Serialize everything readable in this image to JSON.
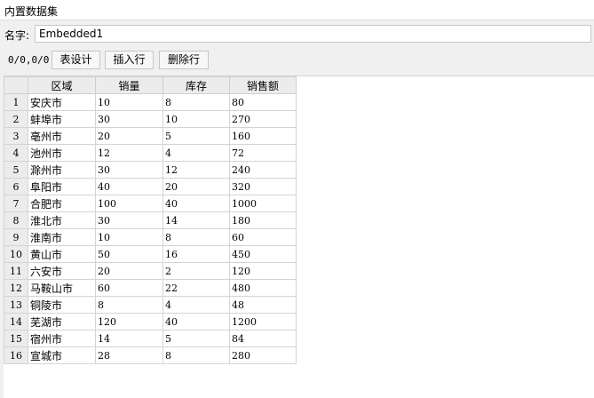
{
  "window": {
    "title": "内置数据集"
  },
  "name_field": {
    "label": "名字:",
    "value": "Embedded1"
  },
  "toolbar": {
    "position_text": "0/0,0/0",
    "design_label": "表设计",
    "insert_label": "插入行",
    "delete_label": "删除行"
  },
  "table": {
    "columns": [
      "区域",
      "销量",
      "库存",
      "销售额"
    ],
    "rows": [
      {
        "num": "1",
        "cells": [
          "安庆市",
          "10",
          "8",
          "80"
        ]
      },
      {
        "num": "2",
        "cells": [
          "蚌埠市",
          "30",
          "10",
          "270"
        ]
      },
      {
        "num": "3",
        "cells": [
          "亳州市",
          "20",
          "5",
          "160"
        ]
      },
      {
        "num": "4",
        "cells": [
          "池州市",
          "12",
          "4",
          "72"
        ]
      },
      {
        "num": "5",
        "cells": [
          "滁州市",
          "30",
          "12",
          "240"
        ]
      },
      {
        "num": "6",
        "cells": [
          "阜阳市",
          "40",
          "20",
          "320"
        ]
      },
      {
        "num": "7",
        "cells": [
          "合肥市",
          "100",
          "40",
          "1000"
        ]
      },
      {
        "num": "8",
        "cells": [
          "淮北市",
          "30",
          "14",
          "180"
        ]
      },
      {
        "num": "9",
        "cells": [
          "淮南市",
          "10",
          "8",
          "60"
        ]
      },
      {
        "num": "10",
        "cells": [
          "黄山市",
          "50",
          "16",
          "450"
        ]
      },
      {
        "num": "11",
        "cells": [
          "六安市",
          "20",
          "2",
          "120"
        ]
      },
      {
        "num": "12",
        "cells": [
          "马鞍山市",
          "60",
          "22",
          "480"
        ]
      },
      {
        "num": "13",
        "cells": [
          "铜陵市",
          "8",
          "4",
          "48"
        ]
      },
      {
        "num": "14",
        "cells": [
          "芜湖市",
          "120",
          "40",
          "1200"
        ]
      },
      {
        "num": "15",
        "cells": [
          "宿州市",
          "14",
          "5",
          "84"
        ]
      },
      {
        "num": "16",
        "cells": [
          "宣城市",
          "28",
          "8",
          "280"
        ]
      }
    ]
  }
}
